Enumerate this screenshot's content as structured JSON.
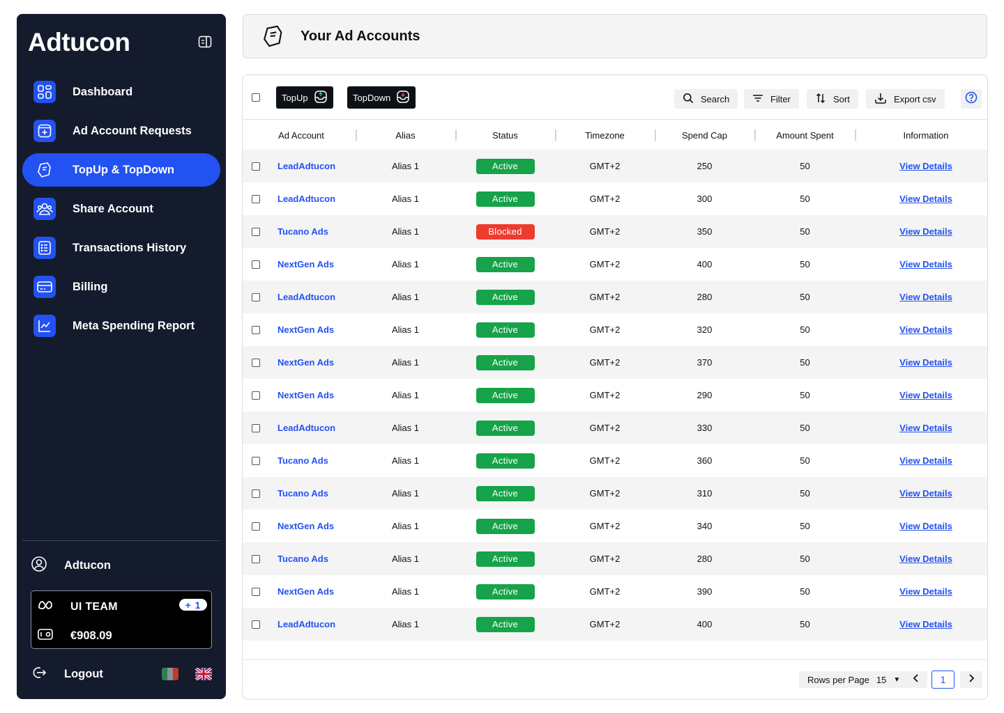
{
  "app": {
    "brand": "Adtucon"
  },
  "sidebar": {
    "items": [
      {
        "label": "Dashboard",
        "icon": "grid-icon",
        "active": false
      },
      {
        "label": "Ad Account Requests",
        "icon": "plus-square-icon",
        "active": false
      },
      {
        "label": "TopUp & TopDown",
        "icon": "money-hand-icon",
        "active": true
      },
      {
        "label": "Share Account",
        "icon": "users-icon",
        "active": false
      },
      {
        "label": "Transactions History",
        "icon": "list-icon",
        "active": false
      },
      {
        "label": "Billing",
        "icon": "card-icon",
        "active": false
      },
      {
        "label": "Meta Spending Report",
        "icon": "chart-icon",
        "active": false
      }
    ],
    "profile_name": "Adtucon",
    "team": {
      "name": "UI TEAM",
      "badge": "+ 1",
      "balance": "€908.09"
    },
    "logout_label": "Logout"
  },
  "header": {
    "title": "Your Ad Accounts"
  },
  "toolbar": {
    "topup_label": "TopUp",
    "topdown_label": "TopDown",
    "search_label": "Search",
    "filter_label": "Filter",
    "sort_label": "Sort",
    "export_label": "Export csv"
  },
  "table": {
    "columns": [
      "Ad Account",
      "Alias",
      "Status",
      "Timezone",
      "Spend Cap",
      "Amount Spent",
      "Information"
    ],
    "rows": [
      {
        "account": "LeadAdtucon",
        "alias": "Alias 1",
        "status": "Active",
        "timezone": "GMT+2",
        "spend_cap": "250",
        "amount_spent": "50",
        "info": "View Details"
      },
      {
        "account": "LeadAdtucon",
        "alias": "Alias 1",
        "status": "Active",
        "timezone": "GMT+2",
        "spend_cap": "300",
        "amount_spent": "50",
        "info": "View Details"
      },
      {
        "account": "Tucano Ads",
        "alias": "Alias 1",
        "status": "Blocked",
        "timezone": "GMT+2",
        "spend_cap": "350",
        "amount_spent": "50",
        "info": "View Details"
      },
      {
        "account": "NextGen Ads",
        "alias": "Alias 1",
        "status": "Active",
        "timezone": "GMT+2",
        "spend_cap": "400",
        "amount_spent": "50",
        "info": "View Details"
      },
      {
        "account": "LeadAdtucon",
        "alias": "Alias 1",
        "status": "Active",
        "timezone": "GMT+2",
        "spend_cap": "280",
        "amount_spent": "50",
        "info": "View Details"
      },
      {
        "account": "NextGen Ads",
        "alias": "Alias 1",
        "status": "Active",
        "timezone": "GMT+2",
        "spend_cap": "320",
        "amount_spent": "50",
        "info": "View Details"
      },
      {
        "account": "NextGen Ads",
        "alias": "Alias 1",
        "status": "Active",
        "timezone": "GMT+2",
        "spend_cap": "370",
        "amount_spent": "50",
        "info": "View Details"
      },
      {
        "account": "NextGen Ads",
        "alias": "Alias 1",
        "status": "Active",
        "timezone": "GMT+2",
        "spend_cap": "290",
        "amount_spent": "50",
        "info": "View Details"
      },
      {
        "account": "LeadAdtucon",
        "alias": "Alias 1",
        "status": "Active",
        "timezone": "GMT+2",
        "spend_cap": "330",
        "amount_spent": "50",
        "info": "View Details"
      },
      {
        "account": "Tucano Ads",
        "alias": "Alias 1",
        "status": "Active",
        "timezone": "GMT+2",
        "spend_cap": "360",
        "amount_spent": "50",
        "info": "View Details"
      },
      {
        "account": "Tucano Ads",
        "alias": "Alias 1",
        "status": "Active",
        "timezone": "GMT+2",
        "spend_cap": "310",
        "amount_spent": "50",
        "info": "View Details"
      },
      {
        "account": "NextGen Ads",
        "alias": "Alias 1",
        "status": "Active",
        "timezone": "GMT+2",
        "spend_cap": "340",
        "amount_spent": "50",
        "info": "View Details"
      },
      {
        "account": "Tucano Ads",
        "alias": "Alias 1",
        "status": "Active",
        "timezone": "GMT+2",
        "spend_cap": "280",
        "amount_spent": "50",
        "info": "View Details"
      },
      {
        "account": "NextGen Ads",
        "alias": "Alias 1",
        "status": "Active",
        "timezone": "GMT+2",
        "spend_cap": "390",
        "amount_spent": "50",
        "info": "View Details"
      },
      {
        "account": "LeadAdtucon",
        "alias": "Alias 1",
        "status": "Active",
        "timezone": "GMT+2",
        "spend_cap": "400",
        "amount_spent": "50",
        "info": "View Details"
      }
    ]
  },
  "pagination": {
    "rows_per_page_label": "Rows per Page",
    "rows_per_page": "15",
    "current_page": "1"
  },
  "colors": {
    "sidebar_bg": "#141b2d",
    "accent": "#2352f2",
    "active": "#16a34a",
    "blocked": "#ef3b2d"
  }
}
